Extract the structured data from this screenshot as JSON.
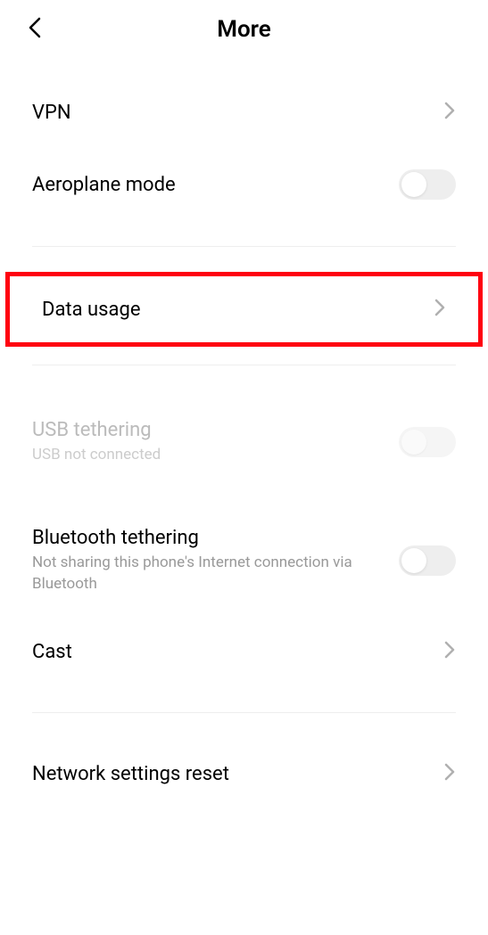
{
  "header": {
    "title": "More"
  },
  "items": {
    "vpn": {
      "label": "VPN"
    },
    "aeroplane": {
      "label": "Aeroplane mode",
      "toggled": false
    },
    "data_usage": {
      "label": "Data usage"
    },
    "usb_tethering": {
      "label": "USB tethering",
      "sublabel": "USB not connected",
      "toggled": false,
      "enabled": false
    },
    "bluetooth_tethering": {
      "label": "Bluetooth tethering",
      "sublabel": "Not sharing this phone's Internet connection via Bluetooth",
      "toggled": false
    },
    "cast": {
      "label": "Cast"
    },
    "network_reset": {
      "label": "Network settings reset"
    }
  },
  "colors": {
    "highlight_border": "#ff0010"
  }
}
